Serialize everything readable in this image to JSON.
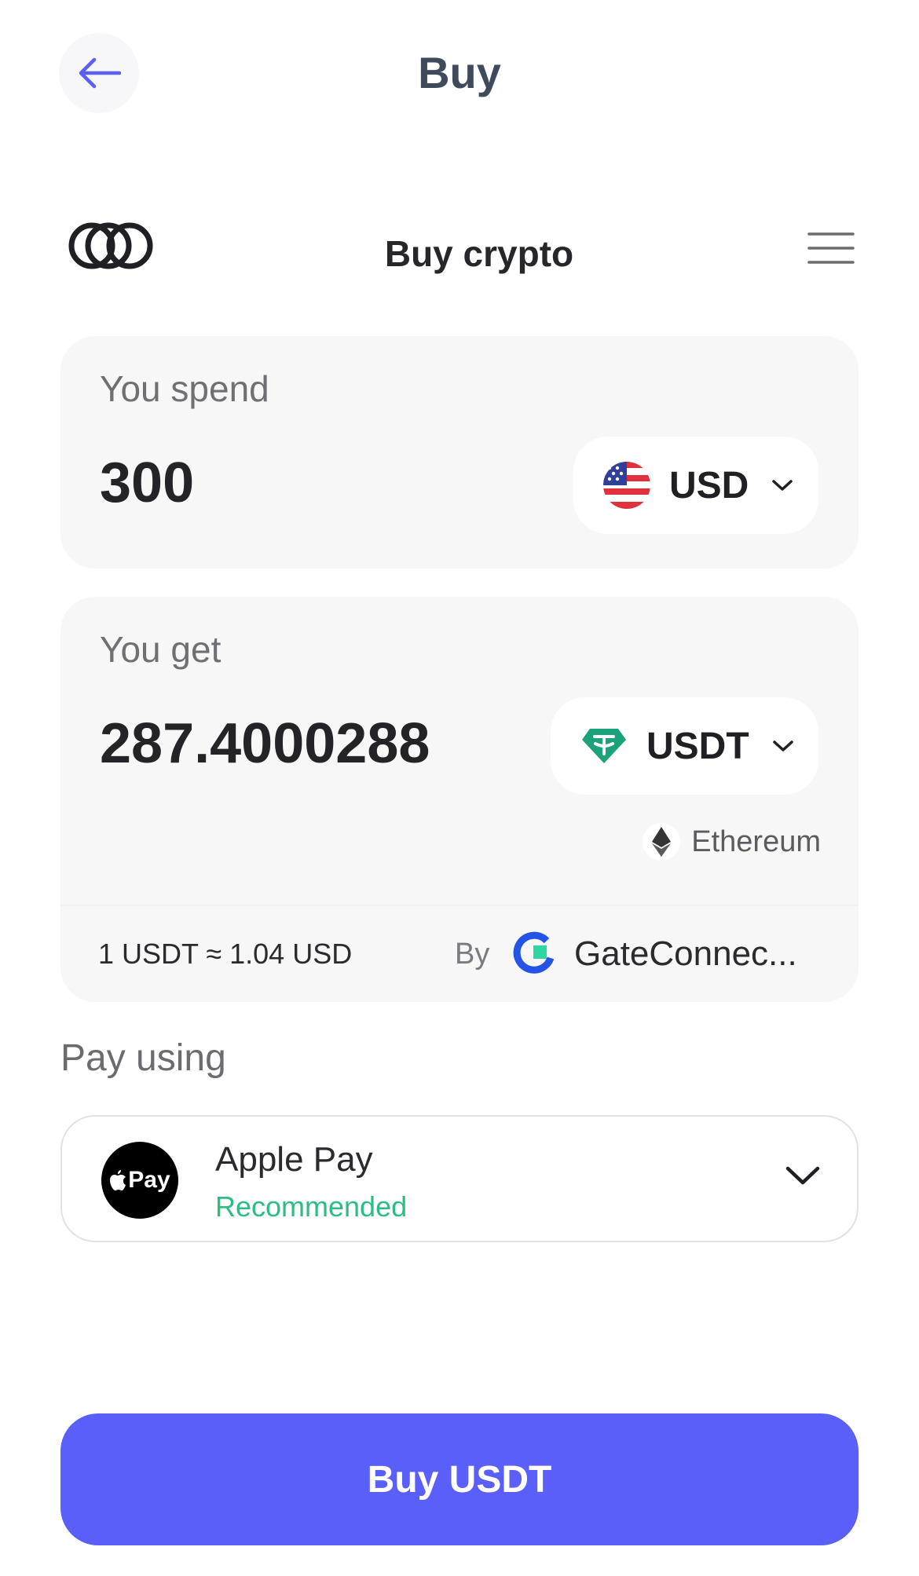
{
  "header": {
    "title": "Buy",
    "back_icon": "arrow-left-icon"
  },
  "widget": {
    "title": "Buy crypto",
    "logo_icon": "rings-logo-icon",
    "menu_icon": "hamburger-menu-icon"
  },
  "spend": {
    "label": "You spend",
    "amount": "300",
    "currency": "USD",
    "currency_icon": "us-flag-icon"
  },
  "get": {
    "label": "You get",
    "amount": "287.4000288",
    "currency": "USDT",
    "currency_icon": "tether-icon",
    "network": "Ethereum",
    "network_icon": "ethereum-icon"
  },
  "quote": {
    "rate": "1 USDT ≈ 1.04 USD",
    "by_label": "By",
    "provider": "GateConnec...",
    "provider_icon": "gateconnect-logo-icon"
  },
  "payment": {
    "label": "Pay using",
    "method": "Apple Pay",
    "badge_text": "Pay",
    "note": "Recommended",
    "note_color": "#2dbd82"
  },
  "cta": {
    "label": "Buy USDT",
    "color": "#5b5ffa"
  }
}
